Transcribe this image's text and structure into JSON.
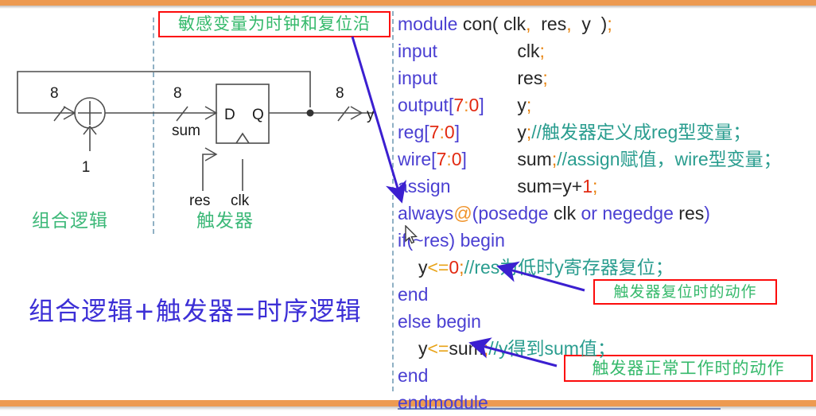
{
  "theme": {
    "accent_bar": "#ed9a51",
    "annotation_border": "#fc0b0b",
    "annotation_text": "#35b96b",
    "keyword": "#4a3fd2",
    "comment": "#2a9d8f",
    "number": "#e22a12",
    "equation": "#3c2fd6",
    "divider": "#8fb0c4"
  },
  "annotations": {
    "top": "敏感变量为时钟和复位沿",
    "reset_action": "触发器复位时的动作",
    "normal_action": "触发器正常工作时的动作"
  },
  "circuit": {
    "adder_input_width": "8",
    "adder_constant": "1",
    "sum_width": "8",
    "sum_label": "sum",
    "output_width": "8",
    "output_label": "y",
    "ff_d": "D",
    "ff_q": "Q",
    "ff_res": "res",
    "ff_clk": "clk"
  },
  "captions": {
    "combinational": "组合逻辑",
    "flipflop": "触发器",
    "equation": "组合逻辑+触发器=时序逻辑"
  },
  "code": {
    "lines": [
      {
        "id": "module",
        "kw": "module",
        "mid": "con(",
        "args": "clk, res, y );"
      },
      {
        "id": "input_clk",
        "kw": "input",
        "col2": "",
        "rest": "clk;"
      },
      {
        "id": "input_res",
        "kw": "input",
        "col2": "",
        "rest": "res;"
      },
      {
        "id": "output",
        "kw": "output",
        "range": "[7:0]",
        "rest": "y;"
      },
      {
        "id": "reg",
        "kw": "reg",
        "range": "[7:0]",
        "rest": "y;",
        "comment": "//触发器定义成reg型变量；"
      },
      {
        "id": "wire",
        "kw": "wire",
        "range": "[7:0]",
        "rest": "sum;",
        "comment": "//assign赋值，wire型变量；"
      },
      {
        "id": "assign",
        "kw": "assign",
        "rest": "sum=y+1;"
      },
      {
        "id": "always",
        "kw": "always",
        "at": "@",
        "rest": "(posedge clk or negedge res)"
      },
      {
        "id": "if",
        "rest": "if(~res) begin"
      },
      {
        "id": "assign_zero",
        "rest": "y<=0;",
        "comment": "//res为低时y寄存器复位；"
      },
      {
        "id": "end1",
        "rest": "end"
      },
      {
        "id": "else",
        "rest": "else begin"
      },
      {
        "id": "assign_sum",
        "rest": "y<=sum;",
        "comment": "//y得到sum值；"
      },
      {
        "id": "end2",
        "rest": "end"
      },
      {
        "id": "endmodule",
        "rest": "endmodule"
      }
    ],
    "tokens": {
      "module": "module",
      "con": "con(",
      "module_args": "clk,  res,  y  );",
      "input": "input",
      "clk_semi": "clk;",
      "res_semi": "res;",
      "output": "output",
      "range": "[7:0]",
      "range_open": "[",
      "range_7": "7",
      "range_colon": ":",
      "range_0": "0",
      "range_close": "]",
      "y_semi": "y;",
      "reg": "reg",
      "wire": "wire",
      "sum_semi": "sum;",
      "assign": "assign",
      "sum_eq": "sum=y+",
      "one": "1",
      "semicolon": ";",
      "always": "always",
      "at": "@",
      "sensitivity": "(posedge clk or negedge res)",
      "if_begin": "if(~res) begin",
      "y_le": "y<=",
      "zero": "0",
      "y_le_sum": "y<=sum",
      "end": "end",
      "else_begin": "else begin",
      "endmodule": "endmodule",
      "comment_reg": "//触发器定义成reg型变量；",
      "comment_wire": "//assign赋值，wire型变量；",
      "comment_reset": "//res为低时y寄存器复位；",
      "comment_sum": "//y得到sum值；"
    }
  }
}
